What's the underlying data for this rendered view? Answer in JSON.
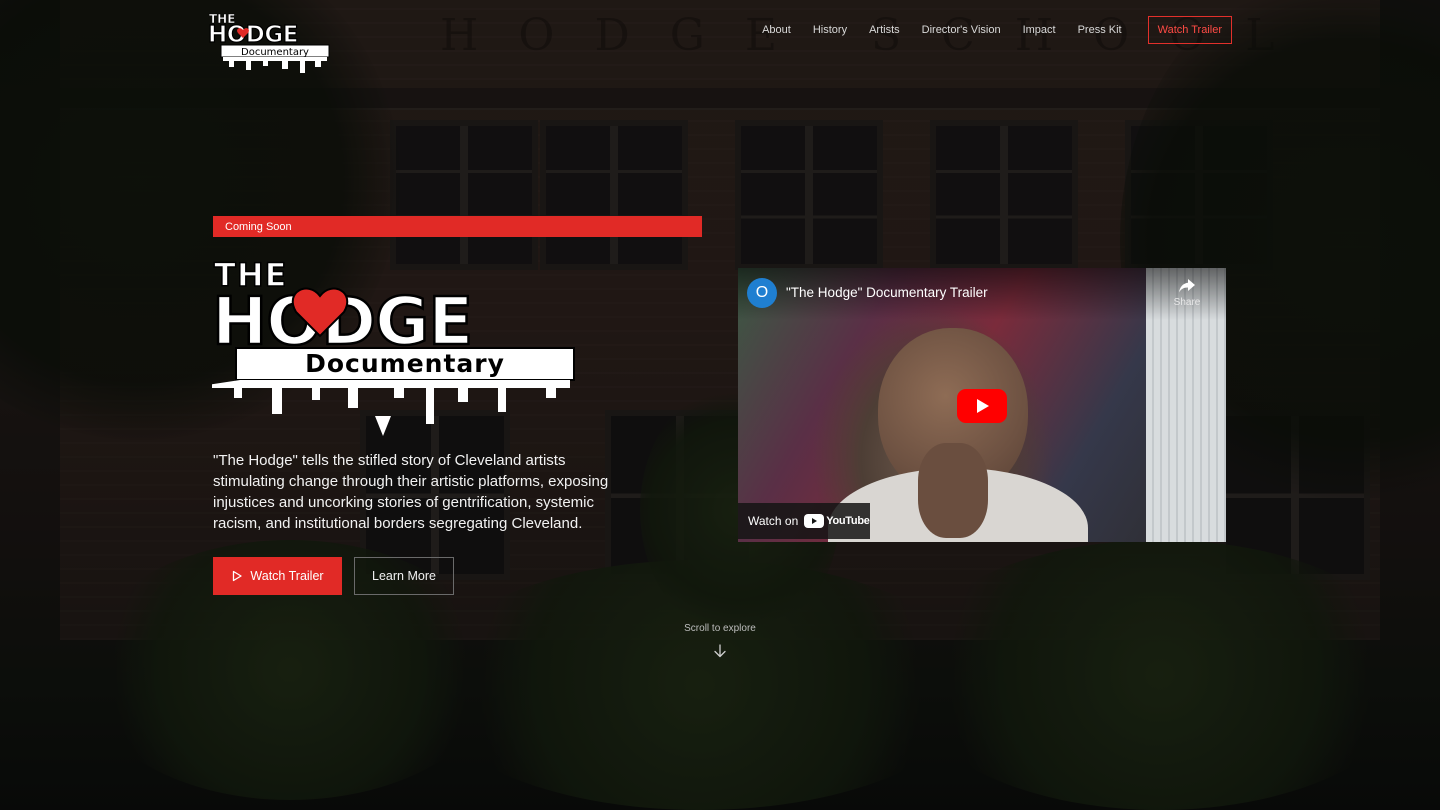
{
  "brand": {
    "name": "The Hodge Documentary",
    "logo_lines": [
      "THE",
      "HODGE",
      "Documentary"
    ],
    "accent_color": "#e12a26"
  },
  "nav": {
    "items": [
      "About",
      "History",
      "Artists",
      "Director's Vision",
      "Impact",
      "Press Kit"
    ],
    "cta_label": "Watch Trailer"
  },
  "hero": {
    "badge": "Coming Soon",
    "description": "\"The Hodge\" tells the stifled story of Cleveland artists stimulating change through their artistic platforms, exposing injustices and uncorking stories of gentrification, systemic racism, and institutional borders segregating Cleveland.",
    "primary_button": "Watch Trailer",
    "secondary_button": "Learn More"
  },
  "video": {
    "channel_initial": "O",
    "title": "\"The Hodge\" Documentary Trailer",
    "share_label": "Share",
    "watch_on": "Watch on",
    "platform": "YouTube",
    "icons": [
      "share-icon",
      "play-icon",
      "youtube-icon"
    ]
  },
  "scroll_hint": {
    "text": "Scroll to explore",
    "icon": "arrow-down-icon"
  },
  "background": {
    "carving": "HODGE SCHOOL"
  }
}
